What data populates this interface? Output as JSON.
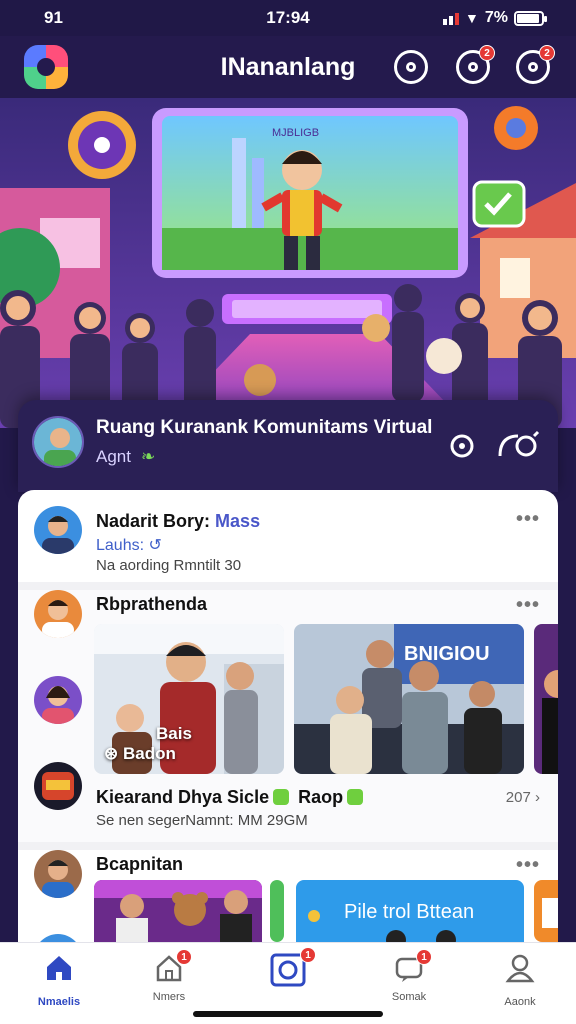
{
  "status_bar": {
    "time_left": "91",
    "time_center": "17:94",
    "battery_text": "7%"
  },
  "app_bar": {
    "title": "INananlang",
    "badge_messages": "2",
    "badge_profile": "2"
  },
  "community": {
    "title": "Ruang Kuranank Komunitams Virtual",
    "subtitle": "Agnt"
  },
  "hero": {
    "screen_label": "MJBLIGB"
  },
  "posts": [
    {
      "name": "Nadarit Bory:",
      "name_accent": "Mass",
      "meta": "Lauhs:",
      "time": "Na aording Rmntilt 30"
    },
    {
      "group_title": "Rbprathenda",
      "photo1_tag_line1": "Bais",
      "photo1_tag_line2": "Badon",
      "photo2_sign": "BNIGIOU",
      "name": "Kiearand Dhya Sicle",
      "name_extra": "Rаор",
      "count": "207",
      "caption": "Se nen segerNamnt: MM 29GM"
    },
    {
      "group_title": "Bcapnitan",
      "banner_text": "Pile trol Bttean"
    }
  ],
  "bottom_nav": [
    {
      "label": "Nmaelis",
      "active": true
    },
    {
      "label": "Nmers",
      "badge": "1"
    },
    {
      "label": "",
      "badge": "1"
    },
    {
      "label": "Somak",
      "badge": "1"
    },
    {
      "label": "Aaonk"
    }
  ],
  "colors": {
    "brand_dark": "#241a4d",
    "accent_blue": "#2f49c2",
    "badge_red": "#e53935"
  }
}
